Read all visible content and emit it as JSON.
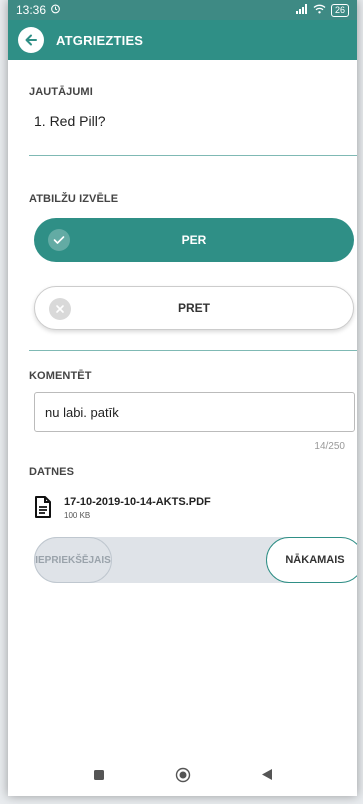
{
  "status_bar": {
    "time": "13:36",
    "battery": "26"
  },
  "header": {
    "title": "ATGRIEZTIES"
  },
  "questions": {
    "label": "JAUTĀJUMI",
    "item": "1. Red Pill?"
  },
  "answers": {
    "label": "ATBILŽU IZVĒLE",
    "options": [
      {
        "label": "PER",
        "selected": true
      },
      {
        "label": "PRET",
        "selected": false
      }
    ]
  },
  "comment": {
    "label": "KOMENTĒT",
    "value": "nu labi. patīk",
    "counter": "14/250"
  },
  "files": {
    "label": "DATNES",
    "items": [
      {
        "name": "17-10-2019-10-14-AKTS.PDF",
        "size": "100 KB"
      }
    ]
  },
  "navigation": {
    "prev": "IEPRIEKŠĒJAIS",
    "next": "NĀKAMAIS"
  },
  "colors": {
    "primary": "#2f8f86",
    "status_bar": "#3e8a84"
  }
}
